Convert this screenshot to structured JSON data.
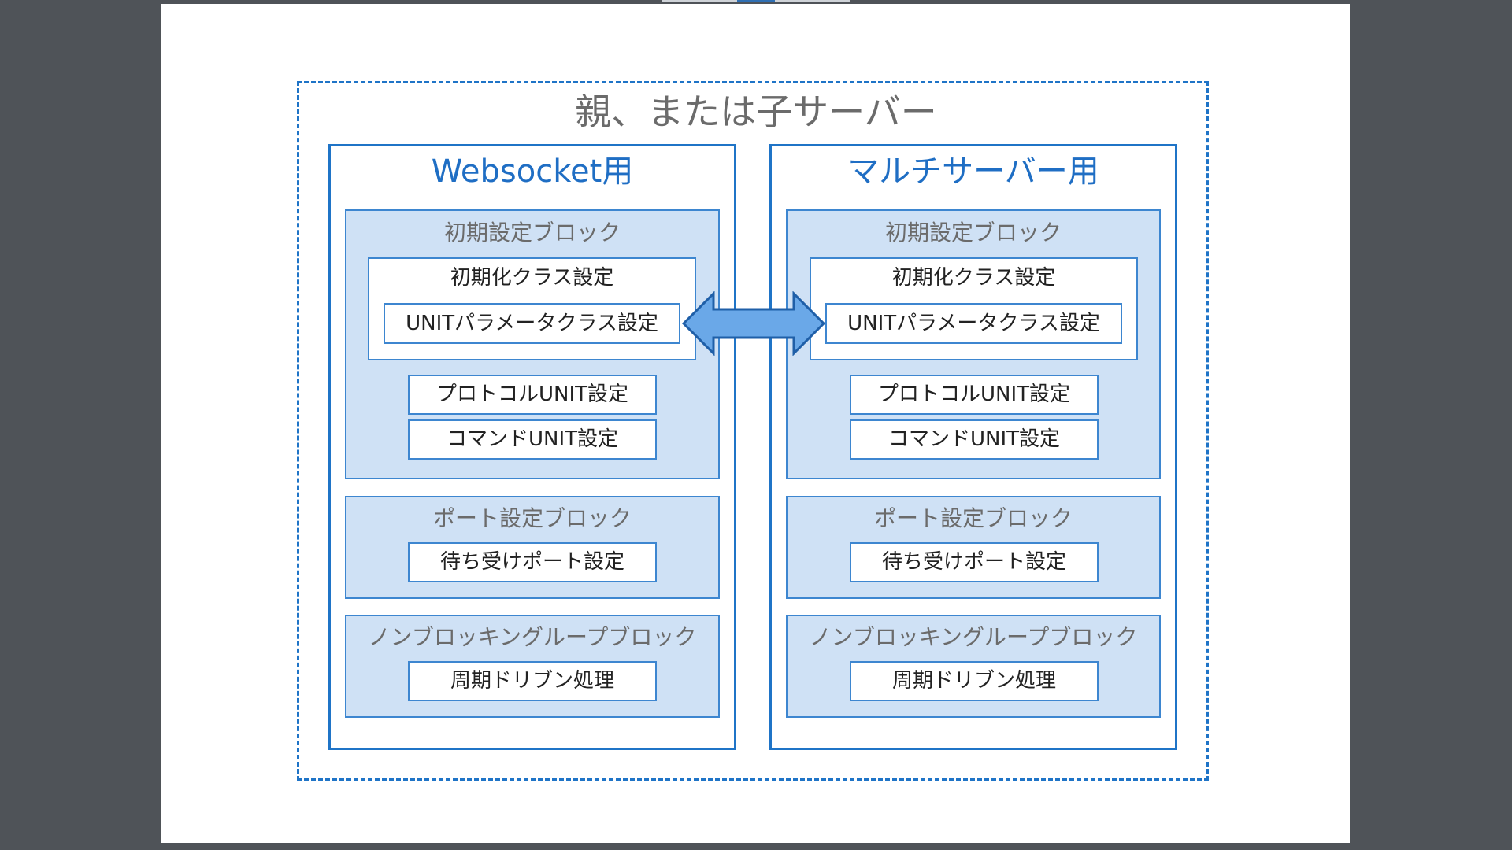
{
  "diagram": {
    "title": "親、または子サーバー",
    "colors": {
      "border": "#1f74c7",
      "block_fill": "#cfe1f5",
      "panel_title": "#1f6ec4",
      "arrow_fill": "#6aa8e8"
    },
    "panels": [
      {
        "title": "Websocket用",
        "init_block": {
          "title": "初期設定ブロック",
          "init_class": "初期化クラス設定",
          "unit_param": "UNITパラメータクラス設定",
          "protocol_unit": "プロトコルUNIT設定",
          "command_unit": "コマンドUNIT設定"
        },
        "port_block": {
          "title": "ポート設定ブロック",
          "listen_port": "待ち受けポート設定"
        },
        "loop_block": {
          "title": "ノンブロッキングループブロック",
          "cycle_driven": "周期ドリブン処理"
        }
      },
      {
        "title": "マルチサーバー用",
        "init_block": {
          "title": "初期設定ブロック",
          "init_class": "初期化クラス設定",
          "unit_param": "UNITパラメータクラス設定",
          "protocol_unit": "プロトコルUNIT設定",
          "command_unit": "コマンドUNIT設定"
        },
        "port_block": {
          "title": "ポート設定ブロック",
          "listen_port": "待ち受けポート設定"
        },
        "loop_block": {
          "title": "ノンブロッキングループブロック",
          "cycle_driven": "周期ドリブン処理"
        }
      }
    ]
  }
}
